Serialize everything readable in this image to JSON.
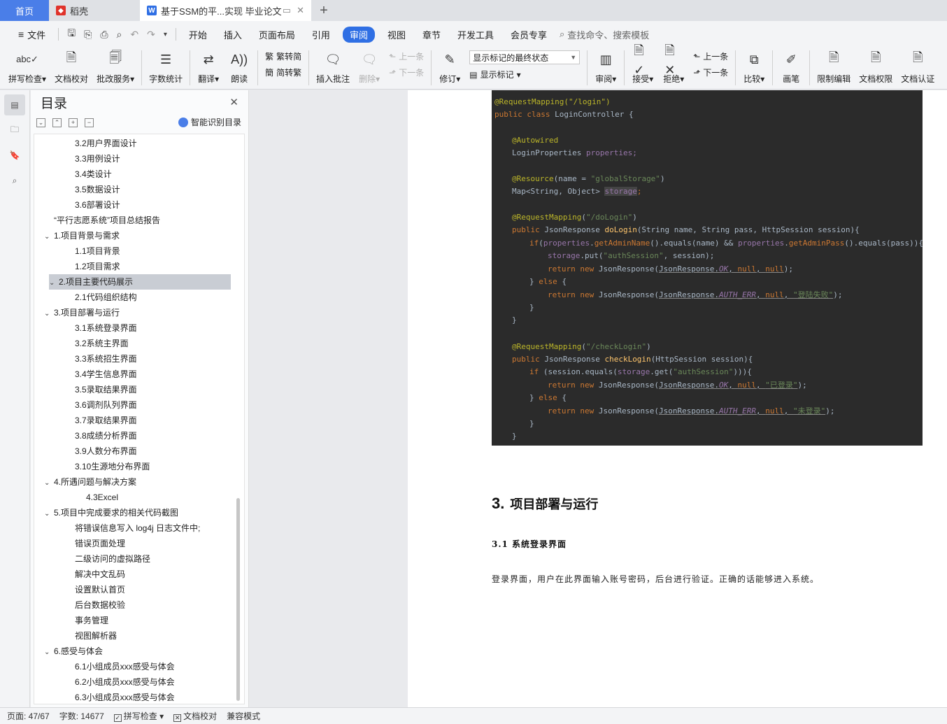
{
  "tabs": {
    "home": "首页",
    "daoke": "稻壳",
    "doc": "基于SSM的平...实现 毕业论文"
  },
  "menu": {
    "file": "文件",
    "items": [
      "开始",
      "插入",
      "页面布局",
      "引用",
      "审阅",
      "视图",
      "章节",
      "开发工具",
      "会员专享"
    ],
    "active": "审阅",
    "search": "查找命令、搜索模板"
  },
  "ribbon": {
    "spell": "拼写检查",
    "proof": "文档校对",
    "batch": "批改服务",
    "wordcount": "字数统计",
    "translate": "翻译",
    "read": "朗读",
    "trad": "繁转简",
    "simp": "简转繁",
    "insert_comment": "插入批注",
    "delete": "删除",
    "prev_comment": "上一条",
    "next_comment": "下一条",
    "revise": "修订",
    "markup_select": "显示标记的最终状态",
    "show_markup": "显示标记",
    "review": "审阅",
    "accept": "接受",
    "reject": "拒绝",
    "prev": "上一条",
    "next": "下一条",
    "compare": "比较",
    "pen": "画笔",
    "restrict": "限制编辑",
    "permission": "文档权限",
    "certify": "文档认证"
  },
  "toc": {
    "title": "目录",
    "smart": "智能识别目录",
    "items": [
      {
        "label": "3.2用户界面设计",
        "level": 2
      },
      {
        "label": "3.3用例设计",
        "level": 2
      },
      {
        "label": "3.4类设计",
        "level": 2
      },
      {
        "label": "3.5数据设计",
        "level": 2
      },
      {
        "label": "3.6部署设计",
        "level": 2
      },
      {
        "label": "“平行志愿系统”项目总结报告",
        "level": 1
      },
      {
        "label": "1.项目背景与需求",
        "level": 1,
        "caret": true
      },
      {
        "label": "1.1项目背景",
        "level": 2
      },
      {
        "label": "1.2项目需求",
        "level": 2
      },
      {
        "label": "2.项目主要代码展示",
        "level": 1,
        "caret": true,
        "selected": true
      },
      {
        "label": "2.1代码组织结构",
        "level": 2
      },
      {
        "label": "3.项目部署与运行",
        "level": 1,
        "caret": true
      },
      {
        "label": "3.1系统登录界面",
        "level": 2
      },
      {
        "label": "3.2系统主界面",
        "level": 2
      },
      {
        "label": "3.3系统招生界面",
        "level": 2
      },
      {
        "label": "3.4学生信息界面",
        "level": 2
      },
      {
        "label": "3.5录取结果界面",
        "level": 2
      },
      {
        "label": "3.6调剂队列界面",
        "level": 2
      },
      {
        "label": "3.7录取结果界面",
        "level": 2
      },
      {
        "label": "3.8成绩分析界面",
        "level": 2
      },
      {
        "label": "3.9人数分布界面",
        "level": 2
      },
      {
        "label": "3.10生源地分布界面",
        "level": 2
      },
      {
        "label": "4.所遇问题与解决方案",
        "level": 1,
        "caret": true
      },
      {
        "label": "4.3Excel",
        "level": 3
      },
      {
        "label": "5.项目中完成要求的相关代码截图",
        "level": 1,
        "caret": true
      },
      {
        "label": "将错误信息写入 log4j 日志文件中;",
        "level": 2
      },
      {
        "label": "错误页面处理",
        "level": 2
      },
      {
        "label": "二级访问的虚拟路径",
        "level": 2
      },
      {
        "label": "解决中文乱码",
        "level": 2
      },
      {
        "label": "设置默认首页",
        "level": 2
      },
      {
        "label": "后台数据校验",
        "level": 2
      },
      {
        "label": "事务管理",
        "level": 2
      },
      {
        "label": "视图解析器",
        "level": 2
      },
      {
        "label": "6.感受与体会",
        "level": 1,
        "caret": true
      },
      {
        "label": "6.1小组成员xxx感受与体会",
        "level": 2
      },
      {
        "label": "6.2小组成员xxx感受与体会",
        "level": 2
      },
      {
        "label": "6.3小组成员xxx感受与体会",
        "level": 2
      }
    ]
  },
  "document": {
    "code": {
      "l1": "@RequestMapping(\"/login\")",
      "l2a": "public class ",
      "l2b": "LoginController {",
      "l3": "@Autowired",
      "l4a": "LoginProperties ",
      "l4b": "properties;",
      "l5a": "@Resource",
      "l5b": "(name = ",
      "l5c": "\"globalStorage\"",
      "l5d": ")",
      "l6a": "Map<String, Object> ",
      "l6b": "storage",
      "l6c": ";",
      "l7a": "@RequestMapping",
      "l7b": "(",
      "l7c": "\"/doLogin\"",
      "l7d": ")",
      "l8a": "public ",
      "l8b": "JsonResponse ",
      "l8c": "doLogin",
      "l8d": "(String name, String pass, HttpSession session){",
      "l9a": "if",
      "l9b": "(",
      "l9c": "properties",
      "l9d": ".",
      "l9e": "getAdminName",
      "l9f": "().equals(name) && ",
      "l9g": "properties",
      "l9h": ".",
      "l9i": "getAdminPass",
      "l9j": "().equals(pass)){",
      "l10a": "storage",
      "l10b": ".put(",
      "l10c": "\"authSession\"",
      "l10d": ", session);",
      "l11a": "return new ",
      "l11b": "JsonResponse(",
      "l11c": "JsonResponse.",
      "l11d": "OK",
      "l11e": ", ",
      "l11f": "null",
      "l11g": ", ",
      "l11h": "null",
      "l11i": ");",
      "l12a": "} ",
      "l12b": "else ",
      "l12c": "{",
      "l13a": "return new ",
      "l13b": "JsonResponse(",
      "l13c": "JsonResponse.",
      "l13d": "AUTH_ERR",
      "l13e": ", ",
      "l13f": "null",
      "l13g": ", ",
      "l13h": "\"登陆失败\"",
      "l13i": ");",
      "l14": "}",
      "l15": "}",
      "l16a": "@RequestMapping",
      "l16b": "(",
      "l16c": "\"/checkLogin\"",
      "l16d": ")",
      "l17a": "public ",
      "l17b": "JsonResponse ",
      "l17c": "checkLogin",
      "l17d": "(HttpSession session){",
      "l18a": "if ",
      "l18b": "(session.equals(",
      "l18c": "storage",
      "l18d": ".get(",
      "l18e": "\"authSession\"",
      "l18f": "))){",
      "l19a": "return new ",
      "l19b": "JsonResponse(",
      "l19c": "JsonResponse.",
      "l19d": "OK",
      "l19e": ", ",
      "l19f": "null",
      "l19g": ", ",
      "l19h": "\"已登录\"",
      "l19i": ");",
      "l20a": "} ",
      "l20b": "else ",
      "l20c": "{",
      "l21a": "return new ",
      "l21b": "JsonResponse(",
      "l21c": "JsonResponse.",
      "l21d": "AUTH_ERR",
      "l21e": ", ",
      "l21f": "null",
      "l21g": ", ",
      "l21h": "\"未登录\"",
      "l21i": ");",
      "l22": "}",
      "l23": "}"
    },
    "heading_num": "3.",
    "heading": "项目部署与运行",
    "subheading": "3.1  系统登录界面",
    "paragraph": "登录界面，用户在此界面输入账号密码，后台进行验证。正确的话能够进入系统。"
  },
  "status": {
    "page": "页面: 47/67",
    "words": "字数: 14677",
    "spell": "拼写检查",
    "proof": "文档校对",
    "compat": "兼容模式"
  },
  "colors": {
    "accent": "#2f6fe4",
    "code_bg": "#2b2b2b"
  }
}
